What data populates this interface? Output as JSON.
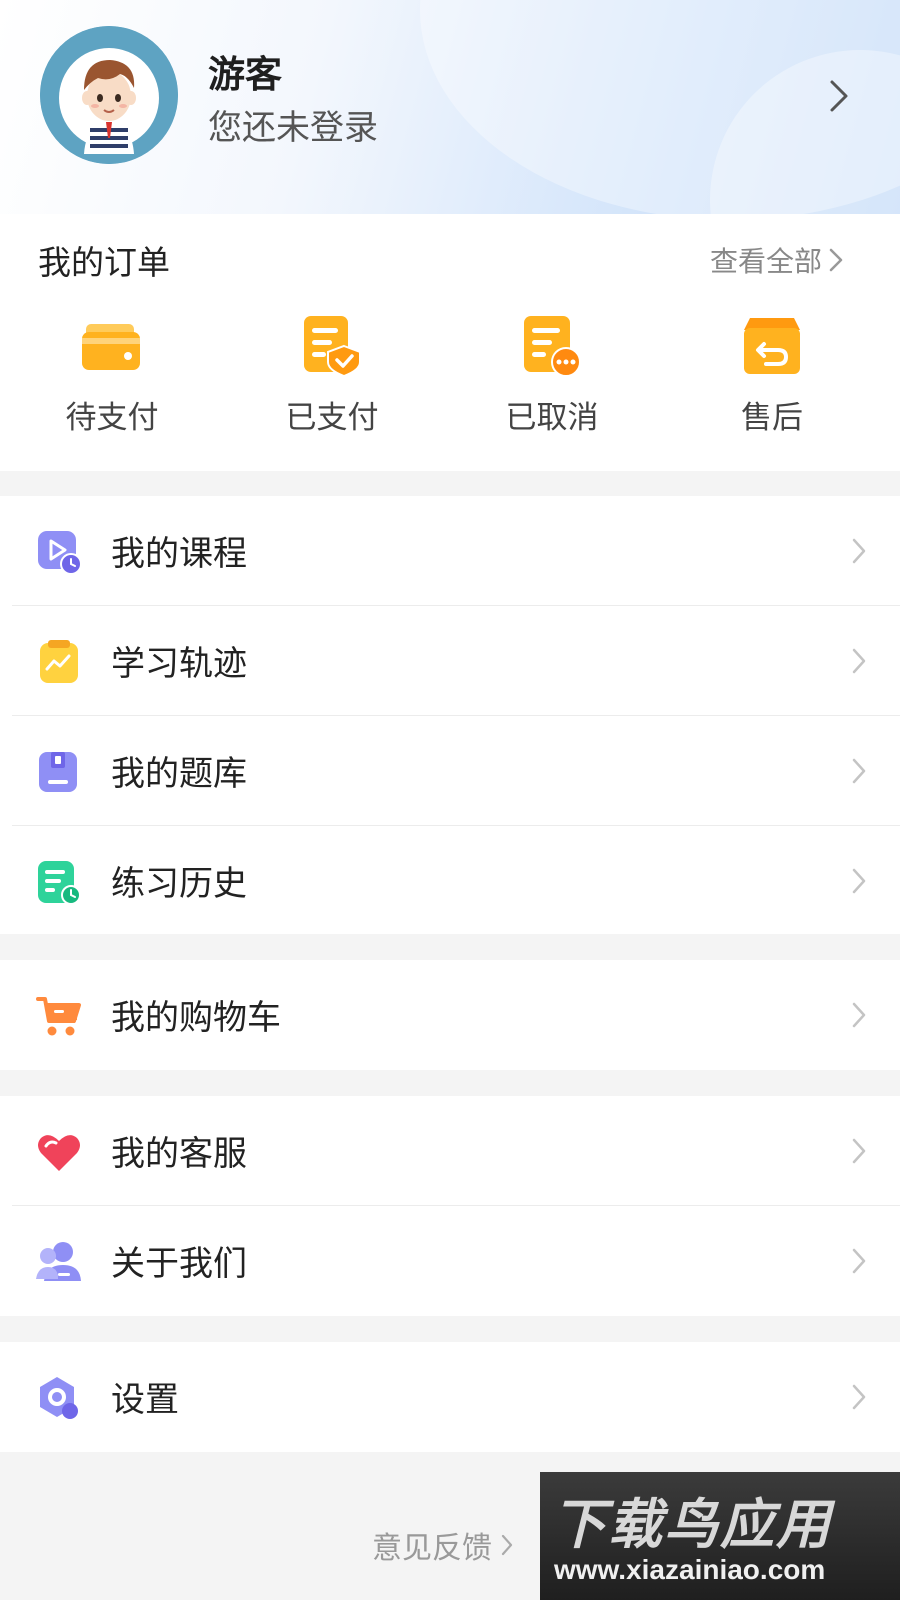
{
  "profile": {
    "name": "游客",
    "status": "您还未登录"
  },
  "orders": {
    "title": "我的订单",
    "view_all": "查看全部",
    "items": [
      {
        "label": "待支付",
        "icon": "wallet-card-icon"
      },
      {
        "label": "已支付",
        "icon": "paid-document-icon"
      },
      {
        "label": "已取消",
        "icon": "cancelled-document-icon"
      },
      {
        "label": "售后",
        "icon": "after-sales-return-icon"
      }
    ]
  },
  "menu": {
    "learning": [
      {
        "label": "我的课程",
        "icon": "video-course-icon"
      },
      {
        "label": "学习轨迹",
        "icon": "clipboard-chart-icon"
      },
      {
        "label": "我的题库",
        "icon": "question-bank-icon"
      },
      {
        "label": "练习历史",
        "icon": "practice-history-icon"
      }
    ],
    "shopping": [
      {
        "label": "我的购物车",
        "icon": "shopping-cart-icon"
      }
    ],
    "support": [
      {
        "label": "我的客服",
        "icon": "heart-service-icon"
      },
      {
        "label": "关于我们",
        "icon": "about-us-user-icon"
      }
    ],
    "settings": [
      {
        "label": "设置",
        "icon": "settings-hexagon-icon"
      }
    ]
  },
  "footer": {
    "feedback": "意见反馈"
  },
  "watermark": {
    "title": "下载鸟应用",
    "url": "www.xiazainiao.com"
  },
  "colors": {
    "order_orange": "#ffb21f",
    "purple": "#8f8ff5",
    "yellow": "#ffd23f",
    "green": "#2ed39a",
    "cart": "#ff8a3d",
    "heart": "#f0435a"
  }
}
